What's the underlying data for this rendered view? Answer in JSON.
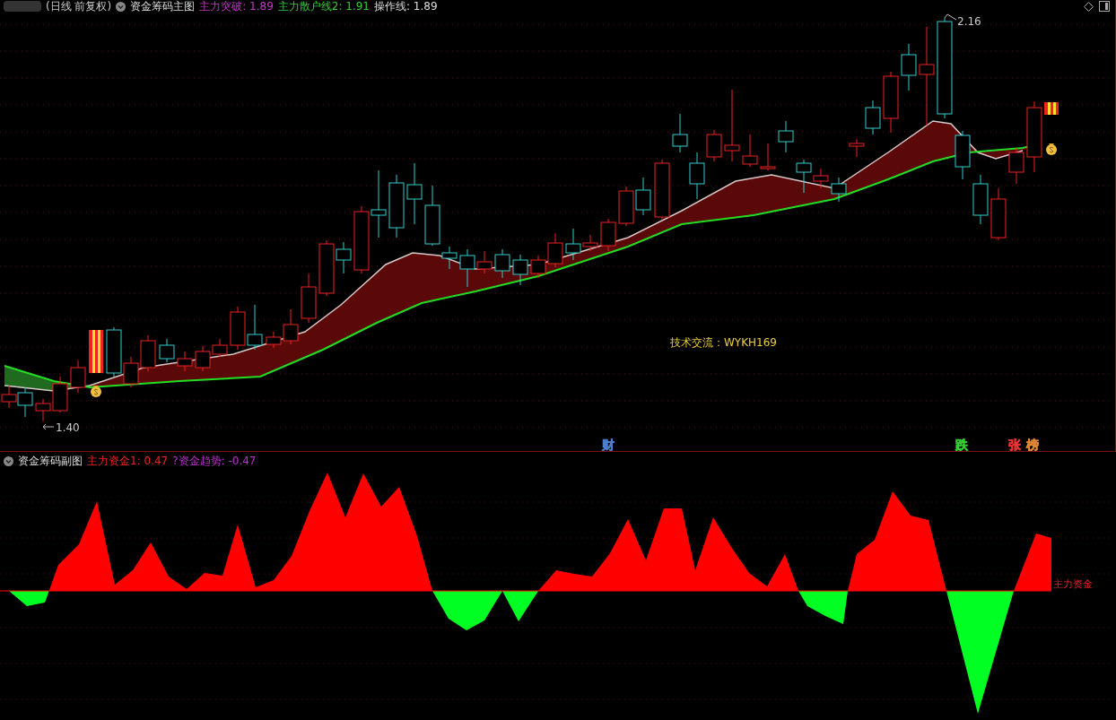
{
  "main_header": {
    "period": "(日线 前复权)",
    "indicator": "资金筹码主图",
    "readouts": [
      {
        "text": "主力突破: 1.89",
        "color": "#cc33cc"
      },
      {
        "text": "主力散户线2: 1.91",
        "color": "#33cc33"
      },
      {
        "text": "操作线: 1.89",
        "color": "#dddddd"
      }
    ]
  },
  "main_chart": {
    "high_label": "2.16",
    "low_label": "1.40",
    "note": "技术交流：WYKH169",
    "signals": [
      {
        "text": "财",
        "color": "#4a7fd0"
      },
      {
        "text": "跌",
        "color": "#33cc33"
      },
      {
        "text": "张",
        "color": "#ee3333"
      },
      {
        "text": "榜",
        "color": "#dd8833"
      }
    ]
  },
  "sub_header": {
    "indicator": "资金筹码副图",
    "readouts": [
      {
        "text": "主力资金1: 0.47",
        "color": "#ee2222"
      },
      {
        "text": "?资金趋势: -0.47",
        "color": "#bb33cc"
      }
    ]
  },
  "sub_chart": {
    "series_label": "主力资金"
  }
}
